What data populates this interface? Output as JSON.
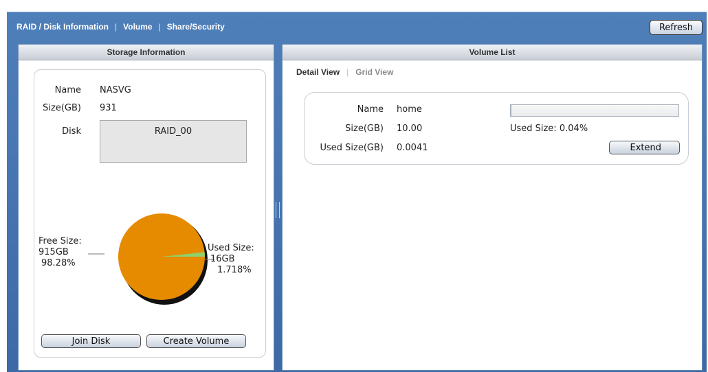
{
  "nav": {
    "tabs": [
      {
        "label": "RAID / Disk Information"
      },
      {
        "label": "Volume"
      },
      {
        "label": "Share/Security"
      }
    ],
    "separator": "|",
    "refresh_label": "Refresh"
  },
  "storage": {
    "header": "Storage Information",
    "name_label": "Name",
    "name_value": "NASVG",
    "size_label": "Size(GB)",
    "size_value": "931",
    "disk_label": "Disk",
    "disk_value": "RAID_00",
    "pie": {
      "free_label": "Free Size:",
      "free_value": "915GB",
      "free_pct": "98.28%",
      "used_label": "Used Size:",
      "used_value": "16GB",
      "used_pct": "1.718%",
      "free_fraction": 0.9828,
      "used_fraction": 0.01718,
      "free_color": "#e68a00",
      "used_color": "#8fd16a"
    },
    "join_label": "Join Disk",
    "create_label": "Create Volume"
  },
  "volume": {
    "header": "Volume List",
    "view_tabs": [
      {
        "label": "Detail View"
      },
      {
        "label": "Grid View"
      }
    ],
    "view_separator": "|",
    "name_label": "Name",
    "name_value": "home",
    "size_label": "Size(GB)",
    "size_value": "10.00",
    "used_label": "Used Size(GB)",
    "used_value": "0.0041",
    "used_pct_text": "Used Size: 0.04%",
    "used_pct_fraction": 0.0004,
    "extend_label": "Extend"
  }
}
